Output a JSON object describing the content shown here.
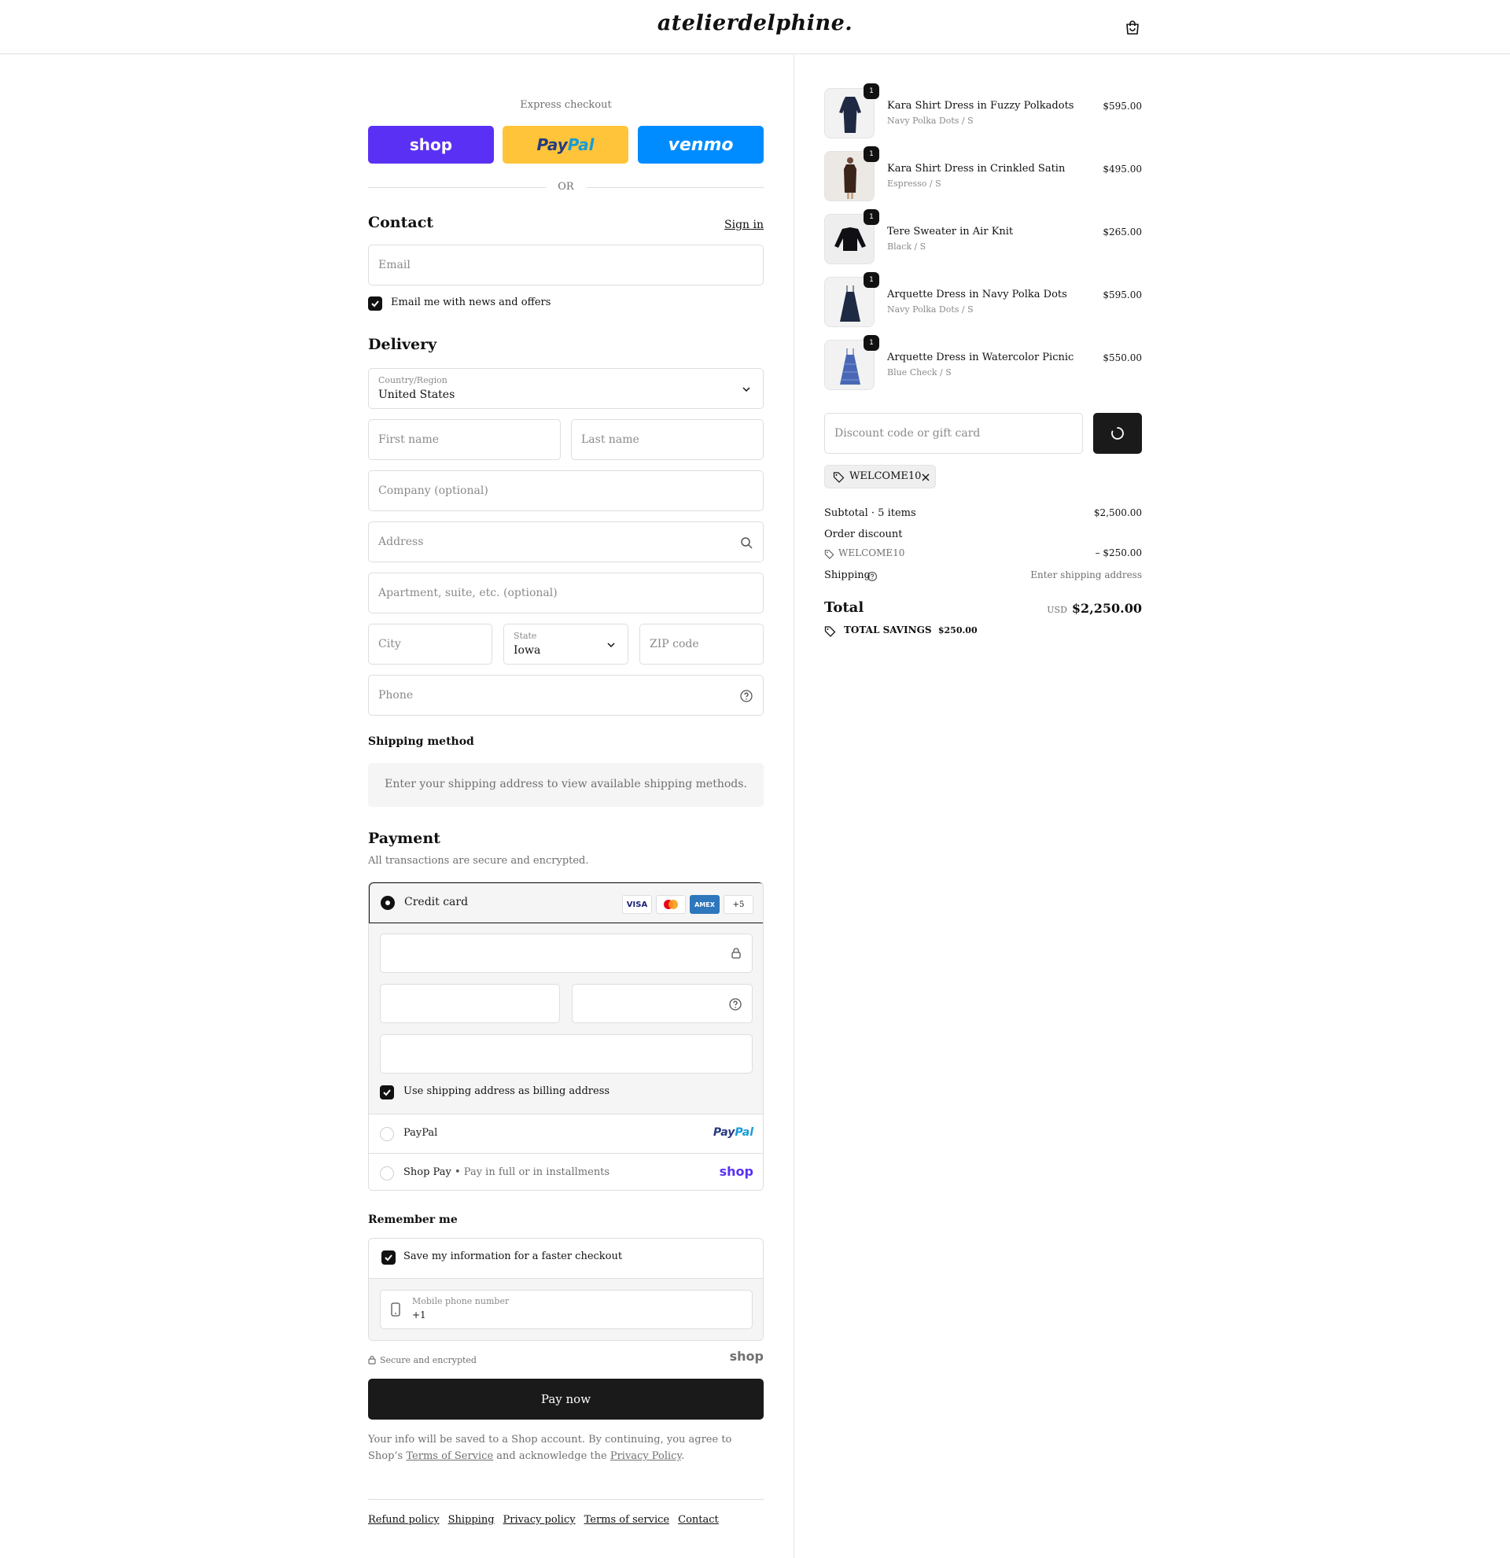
{
  "header": {
    "logo": "atelierdelphine."
  },
  "express": {
    "label": "Express checkout",
    "shop": "shop",
    "paypal_a": "Pay",
    "paypal_b": "Pal",
    "venmo": "venmo",
    "or": "OR"
  },
  "contact": {
    "title": "Contact",
    "sign_in": "Sign in",
    "email_placeholder": "Email",
    "news_label": "Email me with news and offers"
  },
  "delivery": {
    "title": "Delivery",
    "country_label": "Country/Region",
    "country_value": "United States",
    "first_name": "First name",
    "last_name": "Last name",
    "company": "Company (optional)",
    "address": "Address",
    "apartment": "Apartment, suite, etc. (optional)",
    "city": "City",
    "state_label": "State",
    "state_value": "Iowa",
    "zip": "ZIP code",
    "phone": "Phone"
  },
  "shipping_method": {
    "title": "Shipping method",
    "message": "Enter your shipping address to view available shipping methods."
  },
  "payment": {
    "title": "Payment",
    "subtitle": "All transactions are secure and encrypted.",
    "credit_card": "Credit card",
    "brands": [
      "VISA",
      "AMEX",
      "+5"
    ],
    "billing_label": "Use shipping address as billing address",
    "paypal": "PayPal",
    "paypal_logo_a": "Pay",
    "paypal_logo_b": "Pal",
    "shop_pay": "Shop Pay",
    "shop_pay_note": "Pay in full or in installments",
    "shop_logo": "shop"
  },
  "remember": {
    "title": "Remember me",
    "save_label": "Save my information for a faster checkout",
    "mobile_label": "Mobile phone number",
    "mobile_value": "+1"
  },
  "secure": {
    "text": "Secure and encrypted",
    "shop_logo": "shop"
  },
  "pay_now": "Pay now",
  "legal": {
    "part1": "Your info will be saved to a Shop account. By continuing, you agree to Shop’s ",
    "terms": "Terms of Service",
    "part2": " and acknowledge the ",
    "privacy": "Privacy Policy",
    "part3": "."
  },
  "footer": {
    "links": [
      "Refund policy",
      "Shipping",
      "Privacy policy",
      "Terms of service",
      "Contact"
    ]
  },
  "cart": {
    "items": [
      {
        "name": "Kara Shirt Dress in Fuzzy Polkadots",
        "variant": "Navy Polka Dots / S",
        "price": "$595.00",
        "qty": "1"
      },
      {
        "name": "Kara Shirt Dress in Crinkled Satin",
        "variant": "Espresso / S",
        "price": "$495.00",
        "qty": "1"
      },
      {
        "name": "Tere Sweater in Air Knit",
        "variant": "Black / S",
        "price": "$265.00",
        "qty": "1"
      },
      {
        "name": "Arquette Dress in Navy Polka Dots",
        "variant": "Navy Polka Dots / S",
        "price": "$595.00",
        "qty": "1"
      },
      {
        "name": "Arquette Dress in Watercolor Picnic",
        "variant": "Blue Check / S",
        "price": "$550.00",
        "qty": "1"
      }
    ],
    "discount_placeholder": "Discount code or gift card",
    "applied_code": "WELCOME10",
    "subtotal_label": "Subtotal · 5 items",
    "subtotal_value": "$2,500.00",
    "order_discount_label": "Order discount",
    "order_discount_code": "WELCOME10",
    "order_discount_value": "– $250.00",
    "shipping_label": "Shipping",
    "shipping_value": "Enter shipping address",
    "total_label": "Total",
    "total_currency": "USD",
    "total_value": "$2,250.00",
    "savings_label": "TOTAL SAVINGS",
    "savings_value": "$250.00"
  },
  "colors": {
    "accent": "#1a1a1a",
    "shop": "#5a31f4",
    "paypal": "#ffc439",
    "venmo": "#008cff"
  }
}
